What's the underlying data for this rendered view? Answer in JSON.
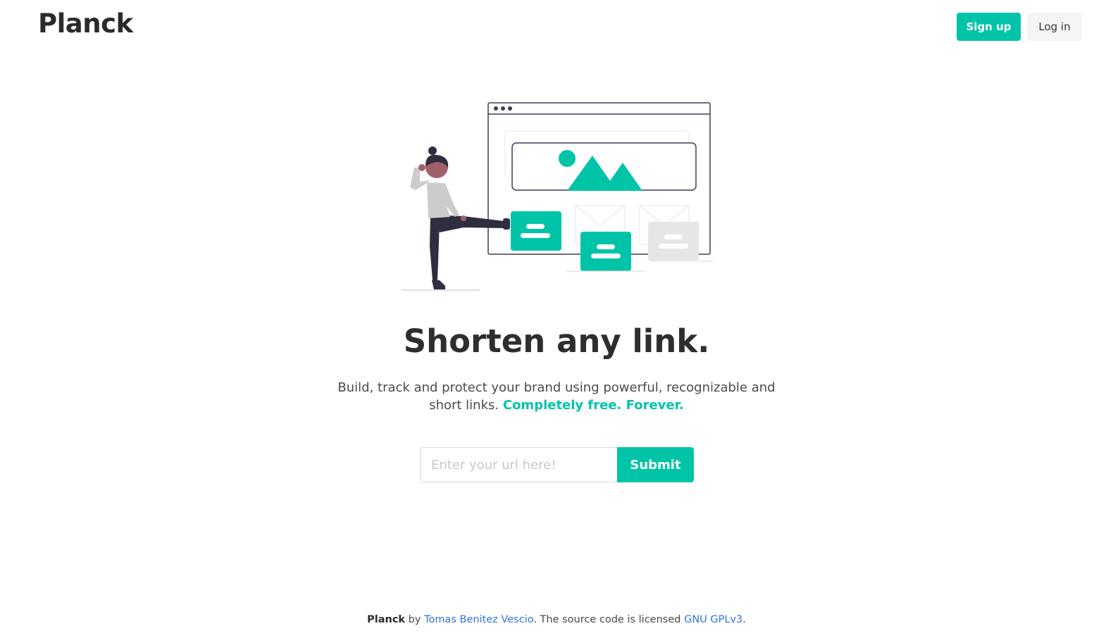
{
  "brand": {
    "name": "Planck"
  },
  "nav": {
    "signup_label": "Sign up",
    "login_label": "Log in"
  },
  "hero": {
    "title": "Shorten any link.",
    "subtitle_text": "Build, track and protect your brand using powerful, recognizable and short links.",
    "subtitle_accent": "Completely free. Forever.",
    "illustration": "person-kicking-website-illustration"
  },
  "form": {
    "url_placeholder": "Enter your url here!",
    "url_value": "",
    "submit_label": "Submit"
  },
  "footer": {
    "brand": "Planck",
    "by_text": "by",
    "author": "Tomas Benitez Vescio",
    "license_text": ". The source code is licensed",
    "license": "GNU GPLv3",
    "end": "."
  },
  "colors": {
    "accent": "#00c4a7",
    "link": "#3273dc",
    "text": "#363636",
    "light_button": "#f5f5f5"
  }
}
